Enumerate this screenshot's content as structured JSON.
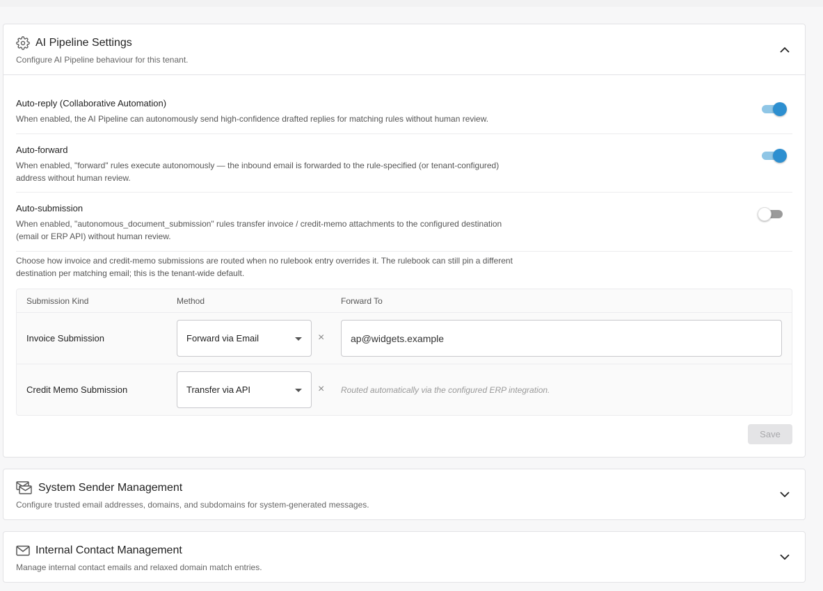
{
  "ai_pipeline": {
    "title": "AI Pipeline Settings",
    "subtitle": "Configure AI Pipeline behaviour for this tenant.",
    "settings": [
      {
        "title": "Auto-reply (Collaborative Automation)",
        "description": "When enabled, the AI Pipeline can autonomously send high-confidence drafted replies for matching rules without human review.",
        "enabled": true
      },
      {
        "title": "Auto-forward",
        "description": "When enabled, \"forward\" rules execute autonomously — the inbound email is forwarded to the rule-specified (or tenant-configured) address without human review.",
        "enabled": true
      },
      {
        "title": "Auto-submission",
        "description": "When enabled, \"autonomous_document_submission\" rules transfer invoice / credit-memo attachments to the configured destination (email or ERP API) without human review.",
        "enabled": false
      }
    ],
    "routing_note": "Choose how invoice and credit-memo submissions are routed when no rulebook entry overrides it. The rulebook can still pin a different destination per matching email; this is the tenant-wide default.",
    "table": {
      "headers": [
        "Submission Kind",
        "Method",
        "Forward To"
      ],
      "rows": [
        {
          "kind": "Invoice Submission",
          "method": "Forward via Email",
          "forward_to": "ap@widgets.example"
        },
        {
          "kind": "Credit Memo Submission",
          "method": "Transfer via API",
          "note": "Routed automatically via the configured ERP integration."
        }
      ]
    },
    "save_label": "Save",
    "clear_glyph": "×"
  },
  "system_sender": {
    "title": "System Sender Management",
    "subtitle": "Configure trusted email addresses, domains, and subdomains for system-generated messages."
  },
  "internal_contact": {
    "title": "Internal Contact Management",
    "subtitle": "Manage internal contact emails and relaxed domain match entries."
  },
  "colors": {
    "toggle_on": "#2d8fd0",
    "toggle_on_track": "#8fc6e6",
    "toggle_off_track": "#9a9a9a"
  },
  "icons": {
    "ai_pipeline": "gear-icon",
    "system_sender": "sender-envelopes-icon",
    "internal_contact": "mail-icon",
    "collapse": "chevron-up-icon",
    "expand": "chevron-down-icon"
  }
}
